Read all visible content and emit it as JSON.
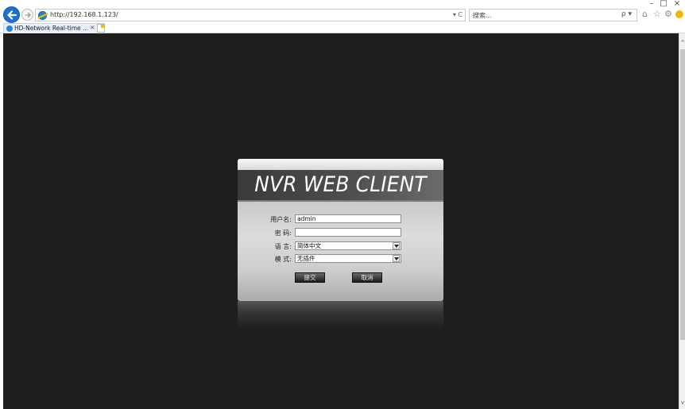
{
  "browser": {
    "url": "http://192.168.1.123/",
    "address_tools": "▾ C",
    "search_placeholder": "搜索...",
    "search_tools": "ρ ▾",
    "tab_title": "HD-Network Real-time ...",
    "tab_close": "×",
    "window_controls": {
      "minimize": "–",
      "maximize": "□",
      "close": "×"
    },
    "icons": [
      "back-arrow-icon",
      "forward-arrow-icon",
      "ie-logo-icon",
      "refresh-icon",
      "search-icon",
      "home-icon",
      "favorites-star-icon",
      "settings-gear-icon",
      "feedback-smiley-icon",
      "new-tab-icon"
    ]
  },
  "login": {
    "title": "NVR WEB CLIENT",
    "username_label": "用户名:",
    "username_value": "admin",
    "password_label": "密 码:",
    "password_value": "",
    "language_label": "语 言:",
    "language_value": "简体中文",
    "mode_label": "模 式:",
    "mode_value": "无插件",
    "submit_label": "提交",
    "cancel_label": "取消"
  },
  "colors": {
    "page_background": "#1e1e1e",
    "banner": "#4a4a4a",
    "panel_body": "#d4d4d4",
    "button": "#2e2e2e",
    "browser_accent": "#1e6fd0"
  }
}
